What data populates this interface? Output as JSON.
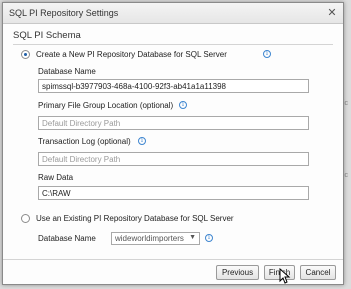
{
  "dialog": {
    "title": "SQL PI Repository Settings",
    "close_glyph": "✕",
    "section_title": "SQL PI Schema"
  },
  "create_new": {
    "label": "Create a New PI Repository Database for SQL Server",
    "selected": true,
    "database_name": {
      "label": "Database Name",
      "value": "spimssql-b3977903-468a-4100-92f3-ab41a1a11398"
    },
    "primary_file_group": {
      "label": "Primary File Group Location (optional)",
      "value": "",
      "placeholder": "Default Directory Path"
    },
    "transaction_log": {
      "label": "Transaction Log (optional)",
      "value": "",
      "placeholder": "Default Directory Path"
    },
    "raw_data": {
      "label": "Raw Data",
      "value": "C:\\RAW"
    }
  },
  "use_existing": {
    "label": "Use an Existing PI Repository Database for SQL Server",
    "selected": false,
    "database_name_label": "Database Name",
    "database_select_value": "wideworldimporters"
  },
  "buttons": {
    "previous": "Previous",
    "finish": "Finish",
    "cancel": "Cancel"
  },
  "icons": {
    "info": "info-icon",
    "close": "close-icon",
    "dropdown": "chevron-down-icon",
    "cursor": "mouse-pointer-icon"
  },
  "colors": {
    "accent": "#3f86d0",
    "radio_selected": "#1f5fa8"
  }
}
